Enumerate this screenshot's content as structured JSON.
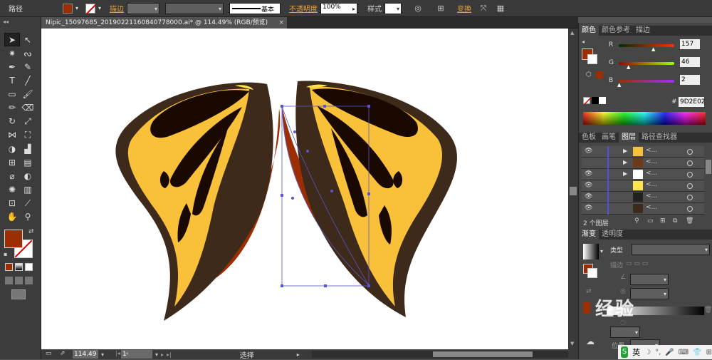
{
  "control_bar": {
    "mode_label": "路径",
    "stroke_label": "描边",
    "stroke_style": "基本",
    "opacity_label": "不透明度",
    "opacity_value": "100%",
    "style_label": "样式",
    "transform_label": "变换",
    "fill_color": "#9d2e02"
  },
  "document": {
    "tab_title": "Nipic_15097685_20190221160840778000.ai* @ 114.49% (RGB/预览)",
    "close": "×"
  },
  "color_panel": {
    "tabs": [
      "颜色",
      "颜色参考",
      "描边"
    ],
    "r_label": "R",
    "r_value": "157",
    "g_label": "G",
    "g_value": "46",
    "b_label": "B",
    "b_value": "2",
    "hex_prefix": "#",
    "hex": "9D2E02"
  },
  "layers_panel": {
    "tabs": [
      "色板",
      "画笔",
      "图层",
      "路径查找器"
    ],
    "layer_name": "<...",
    "footer_label": "2 个图层"
  },
  "gradient_panel": {
    "tabs": [
      "渐变",
      "透明度"
    ],
    "type_label": "类型",
    "stroke_label": "描边",
    "position_label": "位置"
  },
  "status_bar": {
    "zoom": "114.49",
    "page": "1",
    "mode": "选择"
  },
  "watermark": "经验",
  "taskbar": {
    "ime": "英"
  }
}
